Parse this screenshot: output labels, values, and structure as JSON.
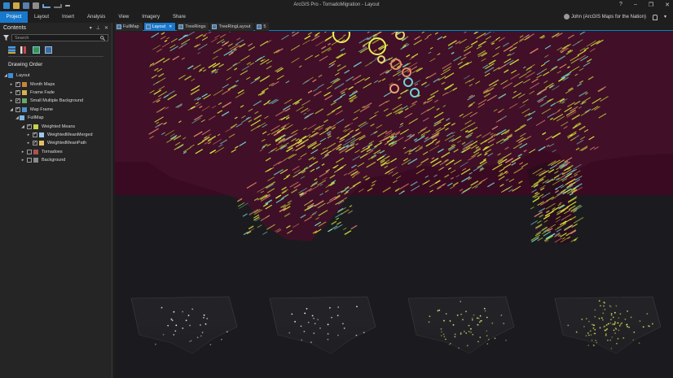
{
  "window": {
    "title": "ArcGIS Pro - TornadoMigration - Layout"
  },
  "title_controls": {
    "help": "?",
    "minimize": "–",
    "restore": "❐",
    "close": "✕"
  },
  "ribbon": {
    "tabs": [
      "Project",
      "Layout",
      "Insert",
      "Analysis",
      "View",
      "Imagery",
      "Share"
    ],
    "user": "John (ArcGIS Maps for the Nation)",
    "user_menu": "▾"
  },
  "contents": {
    "title": "Contents",
    "search_placeholder": "Search",
    "drawing_order_label": "Drawing Order",
    "layers": [
      {
        "label": "Layout",
        "level": 0,
        "expander": "◢",
        "checkbox": false
      },
      {
        "label": "Month Maps",
        "level": 1,
        "expander": "▸",
        "checkbox": true,
        "checked": true
      },
      {
        "label": "Frame Fade",
        "level": 1,
        "expander": "▸",
        "checkbox": true,
        "checked": true
      },
      {
        "label": "Small Multiple Background",
        "level": 1,
        "expander": "▸",
        "checkbox": true,
        "checked": true
      },
      {
        "label": "Map Frame",
        "level": 1,
        "expander": "◢",
        "checkbox": true,
        "checked": true
      },
      {
        "label": "FullMap",
        "level": 2,
        "expander": "◢",
        "checkbox": false
      },
      {
        "label": "Weighted Means",
        "level": 3,
        "expander": "◢",
        "checkbox": true,
        "checked": true
      },
      {
        "label": "WeightedMeanMerged",
        "level": 4,
        "expander": "▸",
        "checkbox": true,
        "checked": true
      },
      {
        "label": "WeightedMeanPath",
        "level": 4,
        "expander": "▸",
        "checkbox": true,
        "checked": true
      },
      {
        "label": "Tornadoes",
        "level": 3,
        "expander": "▸",
        "checkbox": true,
        "checked": false
      },
      {
        "label": "Background",
        "level": 3,
        "expander": "▸",
        "checkbox": true,
        "checked": false
      }
    ]
  },
  "view_tabs": [
    {
      "label": "FullMap",
      "active": false
    },
    {
      "label": "Layout",
      "active": true
    },
    {
      "label": "TreeRings",
      "active": false
    },
    {
      "label": "TreeRingLayout",
      "active": false
    },
    {
      "label": "5",
      "active": false
    }
  ],
  "colors": {
    "accent": "#1778cc",
    "map_background": "#3a0a22",
    "track_yellow": "#d8ec3c",
    "track_cyan": "#6ed6d0",
    "track_salmon": "#e08a6a"
  }
}
